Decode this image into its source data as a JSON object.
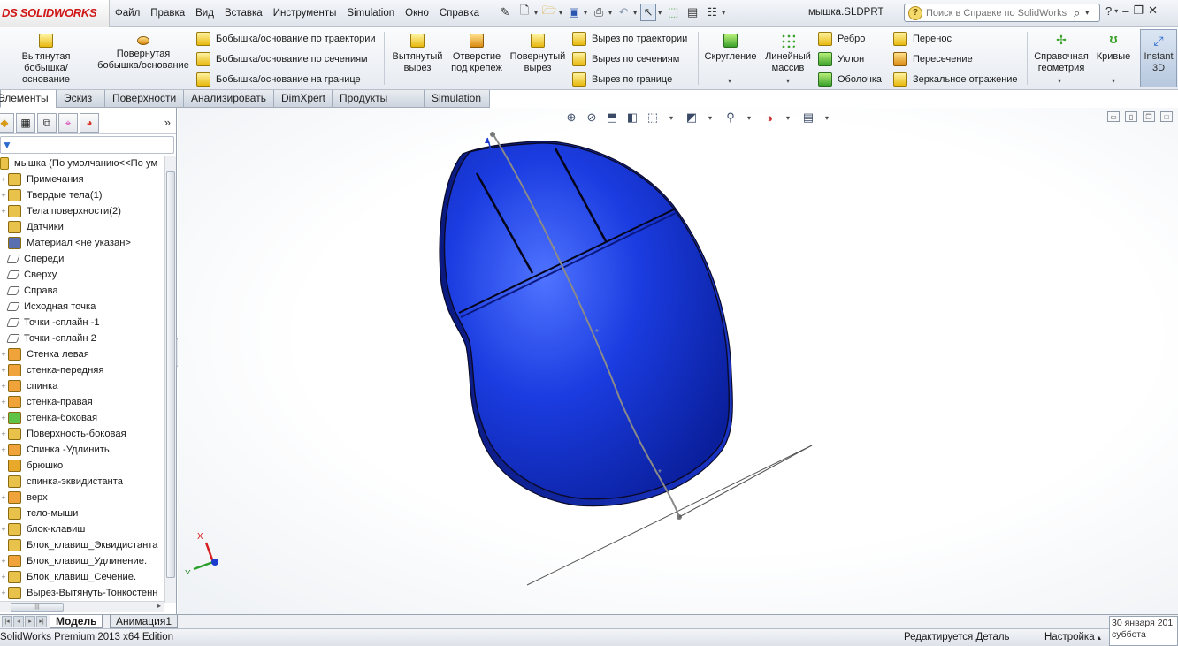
{
  "app": {
    "logo_prefix": "DS",
    "logo_text": "SOLIDWORKS",
    "document_title": "мышка.SLDPRT"
  },
  "menu": {
    "items": [
      "Файл",
      "Правка",
      "Вид",
      "Вставка",
      "Инструменты",
      "Simulation",
      "Окно",
      "Справка"
    ]
  },
  "search": {
    "placeholder": "Поиск в Справке по SolidWorks"
  },
  "commands": {
    "extrude_boss": "Вытянутая бобышка/основание",
    "revolve_boss": "Повернутая бобышка/основание",
    "sweep_boss": "Бобышка/основание по траектории",
    "loft_boss": "Бобышка/основание по сечениям",
    "boundary_boss": "Бобышка/основание на границе",
    "extrude_cut": "Вытянутый вырез",
    "hole_wizard": "Отверстие под крепеж",
    "revolve_cut": "Повернутый вырез",
    "sweep_cut": "Вырез по траектории",
    "loft_cut": "Вырез по сечениям",
    "boundary_cut": "Вырез по границе",
    "fillet": "Скругление",
    "linear_pattern": "Линейный массив",
    "rib": "Ребро",
    "draft": "Уклон",
    "shell": "Оболочка",
    "wrap": "Перенос",
    "intersect": "Пересечение",
    "mirror": "Зеркальное отражение",
    "reference_geometry": "Справочная геометрия",
    "curves": "Кривые",
    "instant3d": "Instant 3D"
  },
  "tabs": [
    "Элементы",
    "Эскиз",
    "Поверхности",
    "Анализировать",
    "DimXpert",
    "Продукты Office",
    "Simulation"
  ],
  "feature_tree": {
    "root": "мышка  (По умолчанию<<По ум",
    "items": [
      {
        "label": "Примечания",
        "icon": "annotations-icon",
        "color": "#e8c24a",
        "expand": "+"
      },
      {
        "label": "Твердые тела(1)",
        "icon": "solid-bodies-icon",
        "color": "#e8c24a",
        "expand": "+"
      },
      {
        "label": "Тела поверхности(2)",
        "icon": "surface-bodies-icon",
        "color": "#e8c24a",
        "expand": "+"
      },
      {
        "label": "Датчики",
        "icon": "sensors-icon",
        "color": "#e8c24a",
        "expand": ""
      },
      {
        "label": "Материал <не указан>",
        "icon": "material-icon",
        "color": "#5a6fb0",
        "expand": ""
      },
      {
        "label": "Спереди",
        "icon": "plane-icon",
        "color": "#ffffff",
        "expand": ""
      },
      {
        "label": "Сверху",
        "icon": "plane-icon",
        "color": "#ffffff",
        "expand": ""
      },
      {
        "label": "Справа",
        "icon": "plane-icon",
        "color": "#ffffff",
        "expand": ""
      },
      {
        "label": "Исходная точка",
        "icon": "origin-icon",
        "color": "#ffffff",
        "expand": ""
      },
      {
        "label": "Точки -сплайн -1",
        "icon": "sketch-3d-icon",
        "color": "#ffffff",
        "expand": ""
      },
      {
        "label": "Точки -сплайн 2",
        "icon": "sketch-icon",
        "color": "#ffffff",
        "expand": ""
      },
      {
        "label": "Стенка левая",
        "icon": "surface-feature-icon",
        "color": "#f0a33a",
        "expand": "+"
      },
      {
        "label": "стенка-передняя",
        "icon": "surface-feature-icon",
        "color": "#f0a33a",
        "expand": "+"
      },
      {
        "label": "спинка",
        "icon": "surface-feature-icon",
        "color": "#f0a33a",
        "expand": "+"
      },
      {
        "label": "стенка-правая",
        "icon": "surface-feature-icon",
        "color": "#f0a33a",
        "expand": "+"
      },
      {
        "label": "стенка-боковая",
        "icon": "fill-surface-icon",
        "color": "#5fc34a",
        "expand": "+"
      },
      {
        "label": "Поверхность-боковая",
        "icon": "surface-feature-icon",
        "color": "#e8c24a",
        "expand": "+"
      },
      {
        "label": "Спинка -Удлинить",
        "icon": "extend-surface-icon",
        "color": "#f0a33a",
        "expand": "+"
      },
      {
        "label": "брюшко",
        "icon": "surface-feature-icon",
        "color": "#e8a82a",
        "expand": ""
      },
      {
        "label": "спинка-эквидистанта",
        "icon": "offset-surface-icon",
        "color": "#e8c24a",
        "expand": ""
      },
      {
        "label": "верх",
        "icon": "extend-surface-icon",
        "color": "#f0a33a",
        "expand": "+"
      },
      {
        "label": "тело-мыши",
        "icon": "knit-surface-icon",
        "color": "#e8c24a",
        "expand": ""
      },
      {
        "label": "блок-клавиш",
        "icon": "extrude-icon",
        "color": "#e8c24a",
        "expand": "+"
      },
      {
        "label": "Блок_клавиш_Эквидистанта",
        "icon": "offset-surface-icon",
        "color": "#e8c24a",
        "expand": ""
      },
      {
        "label": "Блок_клавиш_Удлинение.",
        "icon": "extend-surface-icon",
        "color": "#f0a33a",
        "expand": "+"
      },
      {
        "label": "Блок_клавиш_Сечение.",
        "icon": "loft-icon",
        "color": "#e8c24a",
        "expand": "+"
      },
      {
        "label": "Вырез-Вытянуть-Тонкостенн",
        "icon": "cut-extrude-icon",
        "color": "#e8c24a",
        "expand": "+"
      }
    ]
  },
  "bottom_tabs": {
    "model": "Модель",
    "animation": "Анимация1"
  },
  "status": {
    "edition": "SolidWorks Premium 2013 x64 Edition",
    "state": "Редактируется Деталь",
    "settings": "Настройка",
    "date": "30 января 201",
    "weekday": "суббота"
  },
  "colors": {
    "model_blue": "#1133cc",
    "logo_red": "#d01818"
  },
  "triad": {
    "x_label": "X",
    "y_label": "Y"
  }
}
